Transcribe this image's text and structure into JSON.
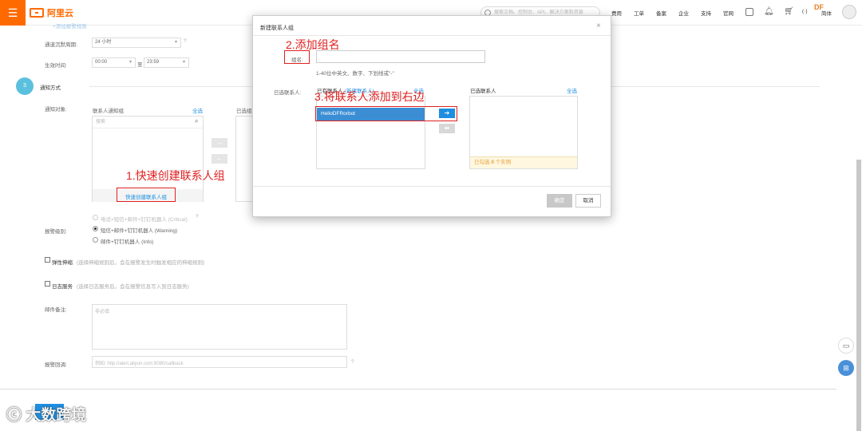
{
  "topbar": {
    "menu_icon": "☰",
    "logo_text": "阿里云",
    "search_placeholder": "搜索文档、控制台、API、解决方案和资源",
    "nav": [
      "费用",
      "工单",
      "备案",
      "企业",
      "支持",
      "官网"
    ],
    "user_badge": "DF",
    "user_label": "简体",
    "lang_icon": "(·)"
  },
  "form": {
    "faded_top_text": "+添加报警规则",
    "silence_label": "通道沉默周期:",
    "silence_value": "24 小时",
    "effective_label": "生效时间:",
    "time_start": "00:00",
    "time_to": "至",
    "time_end": "23:59",
    "step_number": "3",
    "section_title": "通知方式",
    "notify_label": "通知对象:",
    "group_head": "联系人通知组",
    "select_all": "全选",
    "selected_head": "已选组",
    "search_placeholder": "搜索",
    "quick_create": "快速创建联系人组",
    "arrow_right": "→",
    "arrow_left": "←",
    "level_label": "报警级别:",
    "level_critical": "电话+短信+邮件+钉钉机器人 (Critical)",
    "level_warning": "短信+邮件+钉钉机器人 (Warning)",
    "level_info": "邮件+钉钉机器人 (Info)",
    "elastic_label": "弹性伸缩",
    "elastic_desc": "(选择伸缩规则后，会在报警发生时触发相应的伸缩规则)",
    "log_label": "日志服务",
    "log_desc": "(选择日志服务后，会在报警信息写入到日志服务)",
    "mail_note_label": "邮件备注:",
    "mail_note_placeholder": "非必填",
    "callback_label": "报警回调:",
    "callback_placeholder": "例如: http://alert.aliyun.com:8080/callback",
    "help_icon": "?"
  },
  "modal": {
    "title": "新建联系人组",
    "close": "×",
    "group_name_label": "组名:",
    "group_name_value": "",
    "group_name_hint": "1-40位中英文、数字、下划线或\"-\"",
    "contacts_label": "已选联系人:",
    "existing_head": "已有联系人",
    "new_contact_link": "(新建联系人)",
    "select_all": "全选",
    "contact_item": "HelloDFRorbot",
    "selected_head": "已选联系人",
    "selected_count_prefix": "已勾选",
    "selected_count": "0",
    "selected_count_suffix": "个实例",
    "ok": "确定",
    "cancel": "取消",
    "arrow_right": "➔",
    "arrow_left": "⬅"
  },
  "annotations": {
    "step1": "1.快速创建联系人组",
    "step2": "2.添加组名",
    "step3": "3.将联系人添加到右边"
  },
  "watermark": "大数跨境",
  "colors": {
    "brand_orange": "#ff6a00",
    "accent_blue": "#1f8ee0",
    "annotation_red": "#e02020"
  }
}
